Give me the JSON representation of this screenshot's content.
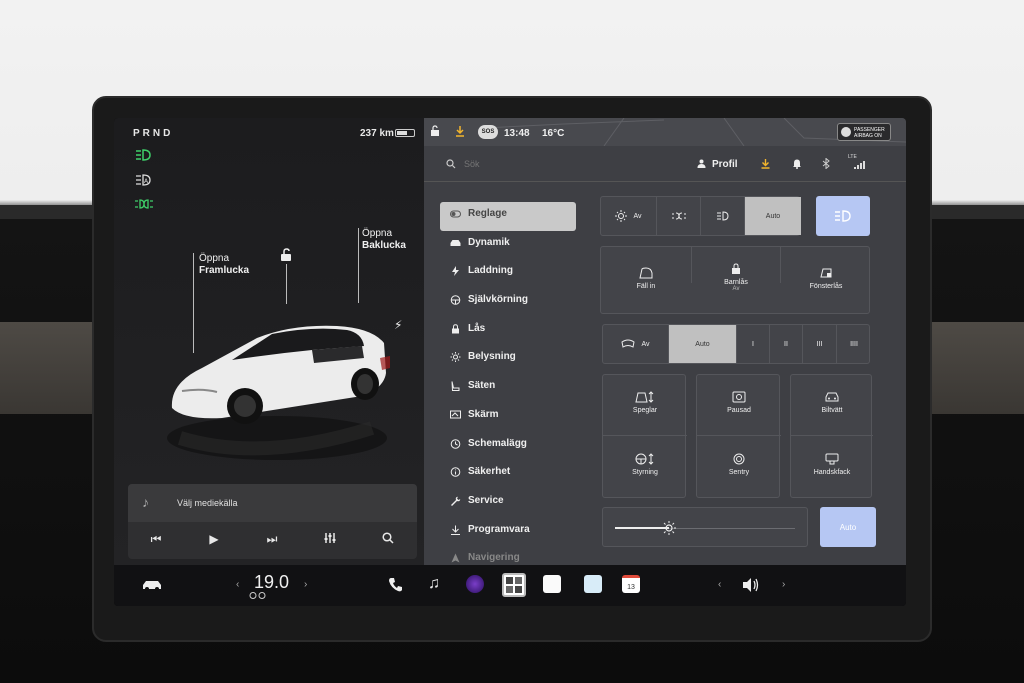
{
  "left_panel": {
    "gear": "PRND",
    "range": "237 km",
    "battery_level": 0.6,
    "front_trunk_label_line1": "Öppna",
    "front_trunk_label_line2": "Framlucka",
    "rear_trunk_label_line1": "Öppna",
    "rear_trunk_label_line2": "Baklucka",
    "media_source_label": "Välj mediekälla"
  },
  "status_bar": {
    "sos": "SOS",
    "time": "13:48",
    "temperature": "16°C",
    "airbag_line1": "PASSENGER",
    "airbag_line2": "AIRBAG ON"
  },
  "search": {
    "placeholder": "Sök"
  },
  "profile": {
    "label": "Profil"
  },
  "network": "LTE",
  "menu": [
    {
      "label": "Reglage",
      "icon": "toggle-icon",
      "active": true
    },
    {
      "label": "Dynamik",
      "icon": "car-icon"
    },
    {
      "label": "Laddning",
      "icon": "bolt-icon"
    },
    {
      "label": "Självkörning",
      "icon": "steering-wheel-icon"
    },
    {
      "label": "Lås",
      "icon": "lock-icon"
    },
    {
      "label": "Belysning",
      "icon": "sun-icon"
    },
    {
      "label": "Säten",
      "icon": "seat-icon"
    },
    {
      "label": "Skärm",
      "icon": "display-icon"
    },
    {
      "label": "Schemalägg",
      "icon": "clock-icon"
    },
    {
      "label": "Säkerhet",
      "icon": "info-icon"
    },
    {
      "label": "Service",
      "icon": "wrench-icon"
    },
    {
      "label": "Programvara",
      "icon": "download-icon"
    },
    {
      "label": "Navigering",
      "icon": "navigation-icon"
    }
  ],
  "controls": {
    "lights": {
      "off": "Av",
      "auto": "Auto"
    },
    "mirrors_fold": "Fäll in",
    "child_lock": "Barnlås",
    "child_lock_state": "Av",
    "window_lock": "Fönsterlås",
    "wipers": {
      "off": "Av",
      "auto": "Auto",
      "levels": [
        "I",
        "II",
        "III",
        "IIII"
      ]
    },
    "mirrors": "Speglar",
    "paused": "Pausad",
    "car_wash": "Biltvätt",
    "steering": "Styrning",
    "sentry": "Sentry",
    "glovebox": "Handskfack",
    "brightness_auto": "Auto",
    "brightness_level": 0.3
  },
  "bottom_bar": {
    "temperature": "19.0",
    "calendar_day": "13"
  }
}
